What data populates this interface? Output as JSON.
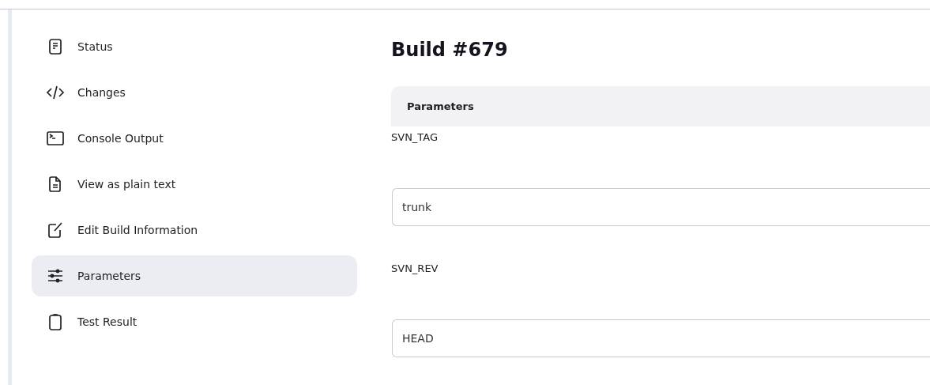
{
  "sidebar": {
    "items": [
      {
        "label": "Status",
        "selected": false
      },
      {
        "label": "Changes",
        "selected": false
      },
      {
        "label": "Console Output",
        "selected": false
      },
      {
        "label": "View as plain text",
        "selected": false
      },
      {
        "label": "Edit Build Information",
        "selected": false
      },
      {
        "label": "Parameters",
        "selected": true
      },
      {
        "label": "Test Result",
        "selected": false
      }
    ]
  },
  "page_title": "Build #679",
  "parameters": {
    "heading": "Parameters",
    "fields": [
      {
        "name": "SVN_TAG",
        "value": "trunk"
      },
      {
        "name": "SVN_REV",
        "value": "HEAD"
      }
    ]
  }
}
